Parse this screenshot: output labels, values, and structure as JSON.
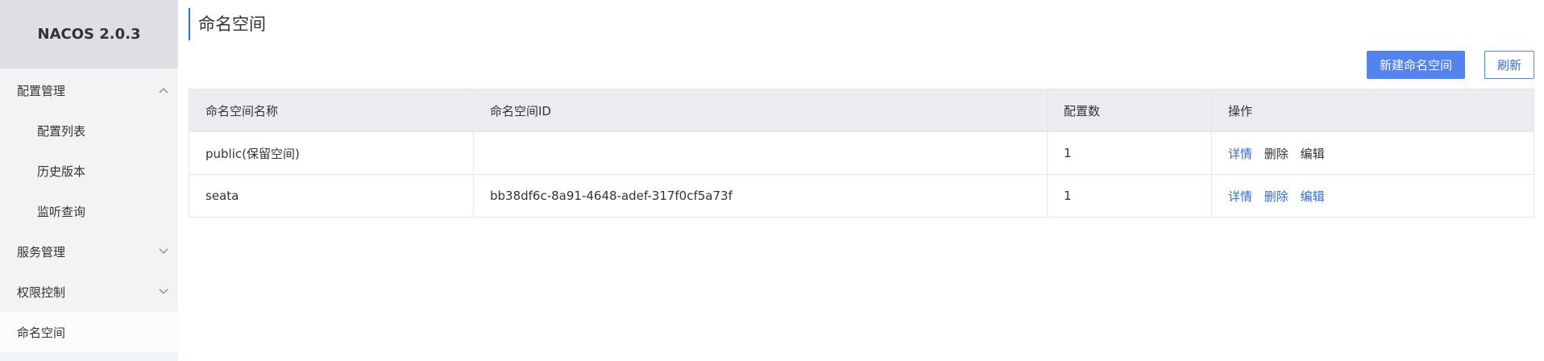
{
  "brand": "NACOS 2.0.3",
  "sidebar": {
    "items": [
      {
        "label": "配置管理",
        "chevron": "up"
      },
      {
        "label": "配置列表"
      },
      {
        "label": "历史版本"
      },
      {
        "label": "监听查询"
      },
      {
        "label": "服务管理",
        "chevron": "down"
      },
      {
        "label": "权限控制",
        "chevron": "down"
      },
      {
        "label": "命名空间",
        "active": true
      }
    ]
  },
  "page": {
    "title": "命名空间",
    "create_button": "新建命名空间",
    "refresh_button": "刷新"
  },
  "table": {
    "headers": [
      "命名空间名称",
      "命名空间ID",
      "配置数",
      "操作"
    ],
    "rows": [
      {
        "name": "public(保留空间)",
        "id": "",
        "count": "1",
        "ops": [
          "详情",
          "删除",
          "编辑"
        ]
      },
      {
        "name": "seata",
        "id": "bb38df6c-8a91-4648-adef-317f0cf5a73f",
        "count": "1",
        "ops": [
          "详情",
          "删除",
          "编辑"
        ]
      }
    ]
  },
  "colors": {
    "accent": "#5284f0",
    "link": "#2f6fe0",
    "sidebar_bg": "#f2f3f5",
    "header_bg": "#dddfe3"
  }
}
